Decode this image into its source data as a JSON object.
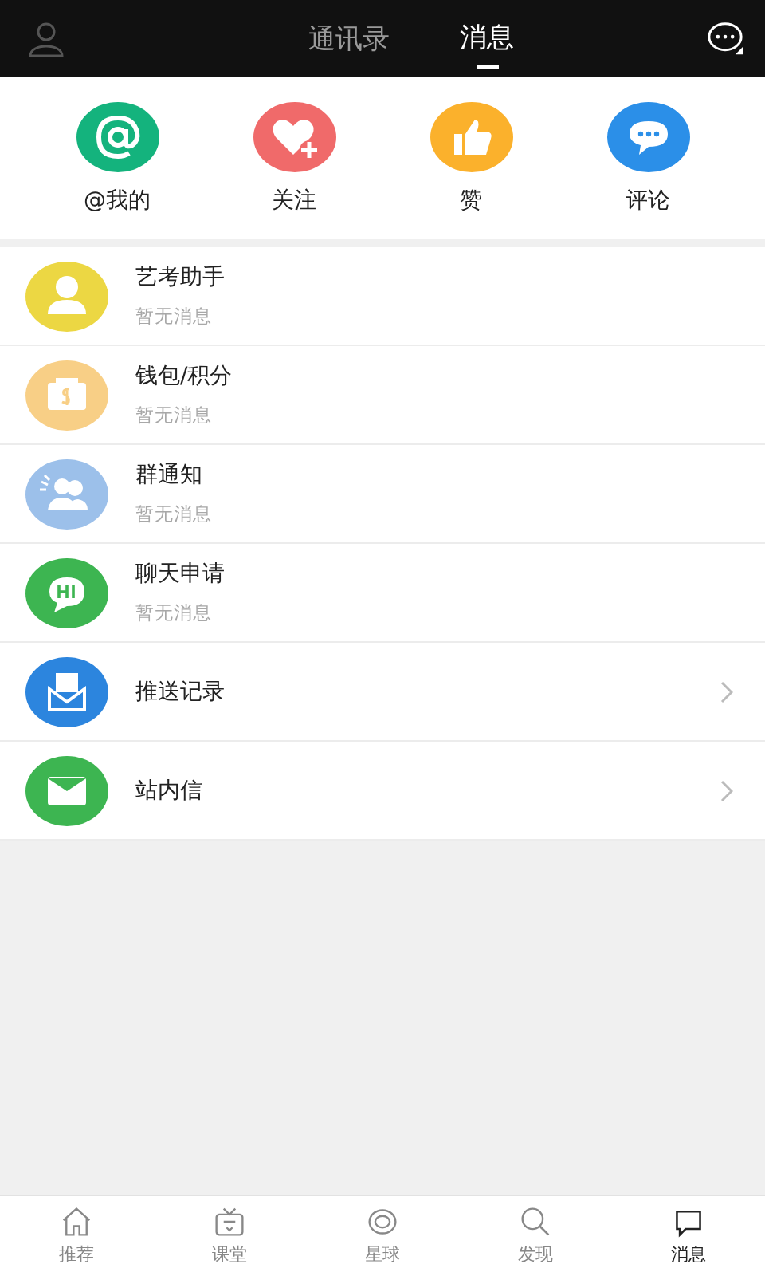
{
  "header": {
    "tabs": [
      {
        "label": "通讯录",
        "selected": false
      },
      {
        "label": "消息",
        "selected": true
      }
    ]
  },
  "quick_actions": [
    {
      "label": "@我的",
      "kind": "at",
      "color": "#14b37d"
    },
    {
      "label": "关注",
      "kind": "heart",
      "color": "#f06a6a"
    },
    {
      "label": "赞",
      "kind": "thumb",
      "color": "#fbb12c"
    },
    {
      "label": "评论",
      "kind": "comment",
      "color": "#2b8fe8"
    }
  ],
  "rows": [
    {
      "title": "艺考助手",
      "subtitle": "暂无消息",
      "kind": "assistant",
      "color": "#ecd743",
      "chevron": false
    },
    {
      "title": "钱包/积分",
      "subtitle": "暂无消息",
      "kind": "wallet",
      "color": "#f8cf86",
      "chevron": false
    },
    {
      "title": "群通知",
      "subtitle": "暂无消息",
      "kind": "group",
      "color": "#9cc0ea",
      "chevron": false
    },
    {
      "title": "聊天申请",
      "subtitle": "暂无消息",
      "kind": "chat",
      "color": "#3db551",
      "chevron": false
    },
    {
      "title": "推送记录",
      "kind": "push",
      "color": "#2c85de",
      "chevron": true
    },
    {
      "title": "站内信",
      "kind": "mail",
      "color": "#3db551",
      "chevron": true
    }
  ],
  "bottom_nav": [
    {
      "label": "推荐",
      "kind": "home",
      "selected": false
    },
    {
      "label": "课堂",
      "kind": "tv",
      "selected": false
    },
    {
      "label": "星球",
      "kind": "planet",
      "selected": false
    },
    {
      "label": "发现",
      "kind": "search",
      "selected": false
    },
    {
      "label": "消息",
      "kind": "message",
      "selected": true
    }
  ]
}
